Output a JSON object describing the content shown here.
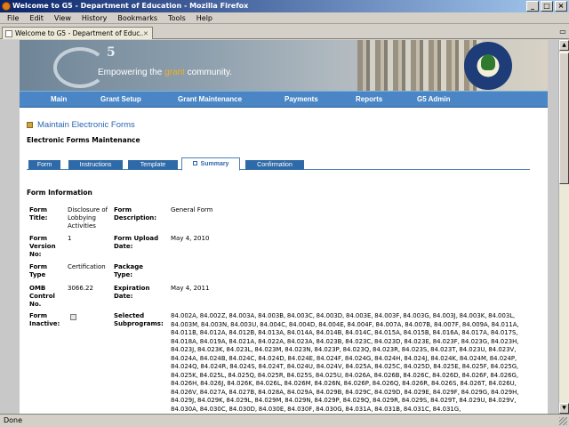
{
  "window": {
    "title": "Welcome to G5 - Department of Education - Mozilla Firefox"
  },
  "menubar": {
    "items": [
      "File",
      "Edit",
      "View",
      "History",
      "Bookmarks",
      "Tools",
      "Help"
    ]
  },
  "browser_tab": {
    "label": "Welcome to G5 - Department of Educ..."
  },
  "banner": {
    "tagline_start": "Empowering the ",
    "tagline_accent": "grant",
    "tagline_end": " community."
  },
  "nav": {
    "items": [
      "Main",
      "Grant Setup",
      "Grant Maintenance",
      "Payments",
      "Reports",
      "G5 Admin"
    ]
  },
  "heading": {
    "title": "Maintain Electronic Forms",
    "section": "Electronic Forms Maintenance"
  },
  "form_tabs": {
    "items": [
      "Form",
      "Instructions",
      "Template",
      "Summary",
      "Confirmation"
    ],
    "active": "Summary"
  },
  "form_info": {
    "title": "Form Information",
    "form_title_label": "Form Title:",
    "form_title_value": "Disclosure of Lobbying Activities",
    "form_description_label": "Form Description:",
    "form_description_value": "General Form",
    "form_version_label": "Form Version No:",
    "form_version_value": "1",
    "form_upload_label": "Form Upload Date:",
    "form_upload_value": "May 4, 2010",
    "form_type_label": "Form Type",
    "form_type_value": "Certification",
    "package_type_label": "Package Type:",
    "package_type_value": "",
    "omb_label": "OMB Control No.",
    "omb_value": "3066.22",
    "expiration_label": "Expiration Date:",
    "expiration_value": "May 4, 2011",
    "inactive_label": "Form Inactive:",
    "inactive_checked": false,
    "subprograms_label": "Selected Subprograms:",
    "subprograms_value": "84.002A, 84.002Z, 84.003A, 84.003B, 84.003C, 84.003D, 84.003E, 84.003F, 84.003G, 84.003J, 84.003K, 84.003L, 84.003M, 84.003N, 84.003U, 84.004C, 84.004D, 84.004E, 84.004F, 84.007A, 84.007B, 84.007F, 84.009A, 84.011A, 84.011B, 84.012A, 84.012B, 84.013A, 84.014A, 84.014B, 84.014C, 84.015A, 84.015B, 84.016A, 84.017A, 84.017S, 84.018A, 84.019A, 84.021A, 84.022A, 84.023A, 84.023B, 84.023C, 84.023D, 84.023E, 84.023F, 84.023G, 84.023H, 84.023J, 84.023K, 84.023L, 84.023M, 84.023N, 84.023P, 84.023Q, 84.023R, 84.023S, 84.023T, 84.023U, 84.023V, 84.024A, 84.024B, 84.024C, 84.024D, 84.024E, 84.024F, 84.024G, 84.024H, 84.024J, 84.024K, 84.024M, 84.024P, 84.024Q, 84.024R, 84.024S, 84.024T, 84.024U, 84.024V, 84.025A, 84.025C, 84.025D, 84.025E, 84.025F, 84.025G, 84.025K, 84.025L, 84.025Q, 84.025R, 84.025S, 84.025U, 84.026A, 84.026B, 84.026C, 84.026D, 84.026F, 84.026G, 84.026H, 84.026J, 84.026K, 84.026L, 84.026M, 84.026N, 84.026P, 84.026Q, 84.026R, 84.026S, 84.026T, 84.026U, 84.026V, 84.027A, 84.027B, 84.028A, 84.029A, 84.029B, 84.029C, 84.029D, 84.029E, 84.029F, 84.029G, 84.029H, 84.029J, 84.029K, 84.029L, 84.029M, 84.029N, 84.029P, 84.029Q, 84.029R, 84.029S, 84.029T, 84.029U, 84.029V, 84.030A, 84.030C, 84.030D, 84.030E, 84.030F, 84.030G, 84.031A, 84.031B, 84.031C, 84.031G,"
  },
  "statusbar": {
    "text": "Done"
  },
  "icons": {
    "app": "firefox-icon",
    "favicon": "page-icon",
    "heading": "form-icon",
    "seal": "department-seal-icon"
  }
}
